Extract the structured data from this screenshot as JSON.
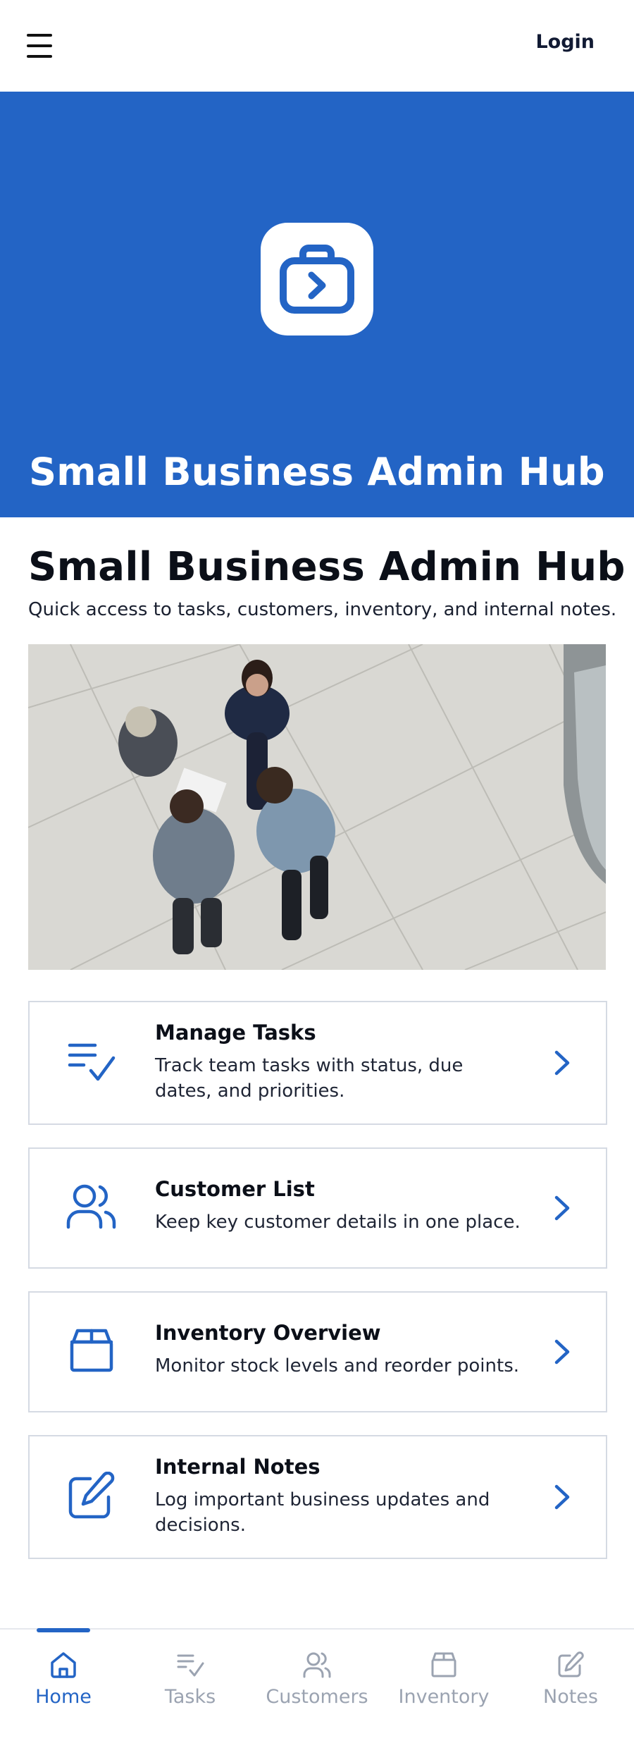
{
  "topbar": {
    "menu_icon": "hamburger-icon",
    "login_label": "Login"
  },
  "hero": {
    "logo_icon": "briefcase-arrow-icon",
    "title": "Small Business Admin Hub",
    "background_color": "#2364c5"
  },
  "intro": {
    "title": "Small Business Admin Hub",
    "subtitle": "Quick access to tasks, customers, inventory, and internal notes."
  },
  "cards": [
    {
      "icon": "task-list-check-icon",
      "title": "Manage Tasks",
      "description": "Track team tasks with status, due dates, and priorities."
    },
    {
      "icon": "users-icon",
      "title": "Customer List",
      "description": "Keep key customer details in one place."
    },
    {
      "icon": "box-icon",
      "title": "Inventory Overview",
      "description": "Monitor stock levels and reorder points."
    },
    {
      "icon": "edit-icon",
      "title": "Internal Notes",
      "description": "Log important business updates and decisions."
    }
  ],
  "bottom_nav": {
    "items": [
      {
        "label": "Home",
        "icon": "home-icon",
        "active": true
      },
      {
        "label": "Tasks",
        "icon": "task-list-check-icon",
        "active": false
      },
      {
        "label": "Customers",
        "icon": "users-icon",
        "active": false
      },
      {
        "label": "Inventory",
        "icon": "box-icon",
        "active": false
      },
      {
        "label": "Notes",
        "icon": "edit-icon",
        "active": false
      }
    ]
  },
  "colors": {
    "accent": "#2364c5",
    "inactive_nav": "#9ba3b1",
    "card_border": "#d5dae3"
  }
}
